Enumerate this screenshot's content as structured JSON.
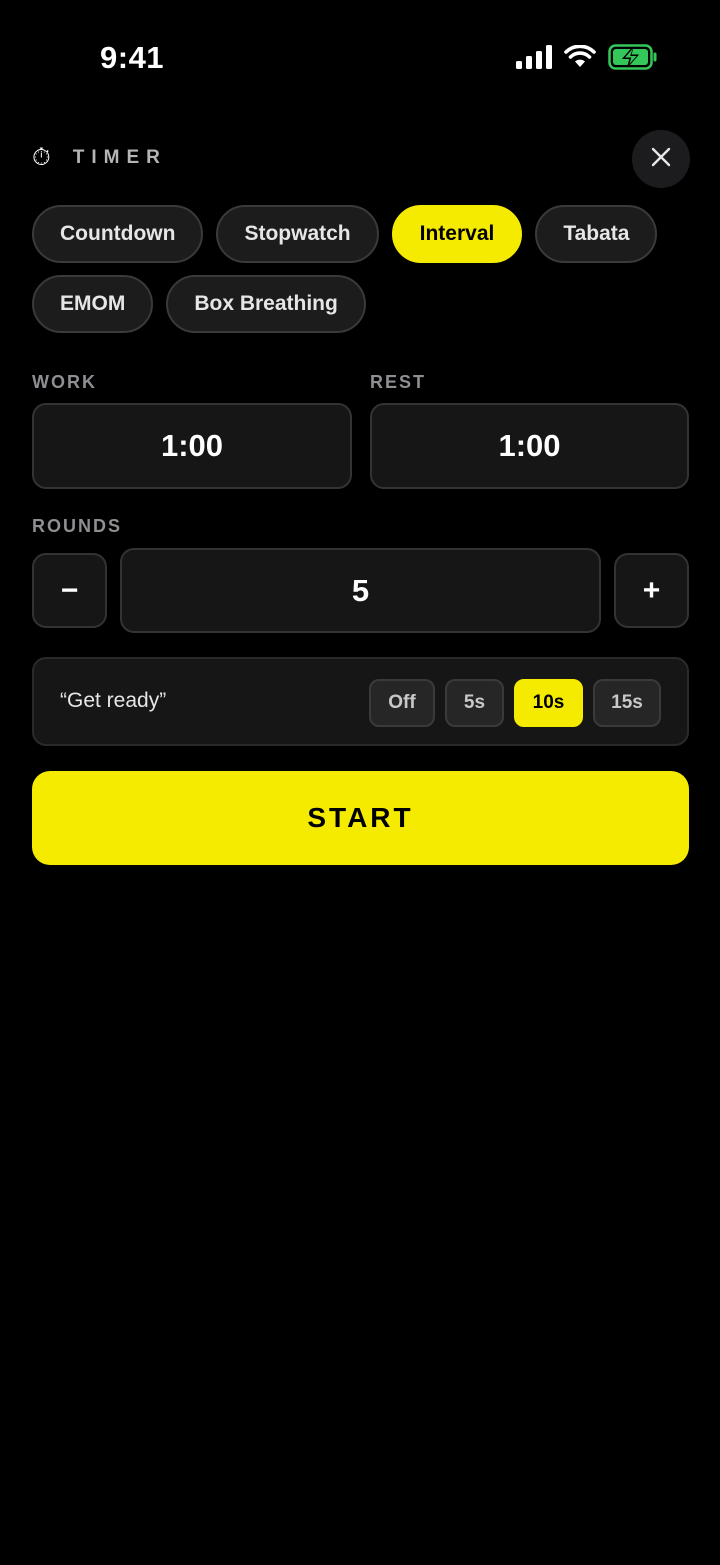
{
  "status_bar": {
    "time": "9:41",
    "icons": [
      "signal-icon",
      "wifi-icon",
      "battery-charging-icon"
    ],
    "battery_color": "#34c759"
  },
  "header": {
    "icon": "⏱",
    "title": "TIMER",
    "close_icon": "close-icon"
  },
  "modes": [
    {
      "label": "Countdown",
      "active": false
    },
    {
      "label": "Stopwatch",
      "active": false
    },
    {
      "label": "Interval",
      "active": true
    },
    {
      "label": "Tabata",
      "active": false
    },
    {
      "label": "EMOM",
      "active": false
    },
    {
      "label": "Box Breathing",
      "active": false
    }
  ],
  "work": {
    "label": "WORK",
    "value": "1:00"
  },
  "rest": {
    "label": "REST",
    "value": "1:00"
  },
  "rounds": {
    "label": "ROUNDS",
    "value": "5",
    "decrement": "−",
    "increment": "+"
  },
  "get_ready": {
    "label": "“Get ready”",
    "options": [
      {
        "label": "Off",
        "active": false
      },
      {
        "label": "5s",
        "active": false
      },
      {
        "label": "10s",
        "active": true
      },
      {
        "label": "15s",
        "active": false
      }
    ]
  },
  "start_label": "START",
  "colors": {
    "accent": "#f5eb00",
    "background": "#000000",
    "surface": "#161616"
  }
}
